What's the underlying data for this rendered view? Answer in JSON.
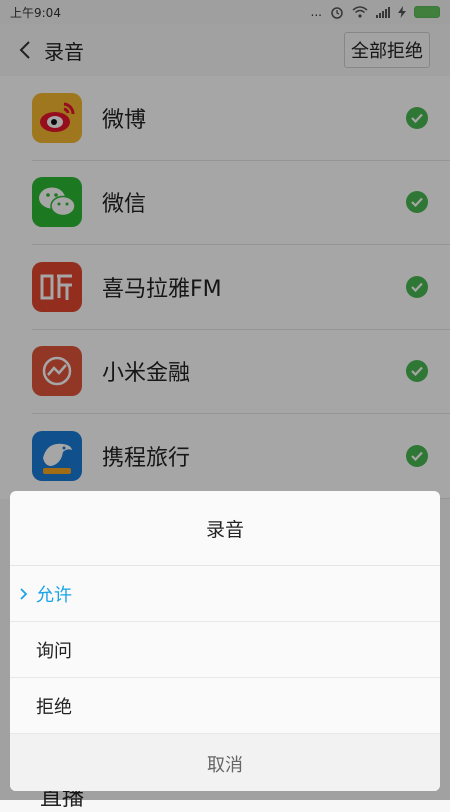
{
  "status": {
    "time": "上午9:04",
    "dots": "...",
    "icons": [
      "alarm-icon",
      "wifi-icon",
      "signal-icon",
      "charging-icon",
      "battery-icon"
    ]
  },
  "header": {
    "title": "录音",
    "deny_all": "全部拒绝"
  },
  "apps": [
    {
      "name": "微博",
      "icon": "weibo-icon",
      "color": "#f4b730"
    },
    {
      "name": "微信",
      "icon": "wechat-icon",
      "color": "#2db935"
    },
    {
      "name": "喜马拉雅FM",
      "icon": "ximalaya-icon",
      "color": "#e2452f"
    },
    {
      "name": "小米金融",
      "icon": "mi-finance-icon",
      "color": "#e0553b"
    },
    {
      "name": "携程旅行",
      "icon": "ctrip-icon",
      "color": "#1a7bd7"
    }
  ],
  "peek_item": "直播",
  "sheet": {
    "title": "录音",
    "options": [
      {
        "label": "允许",
        "selected": true
      },
      {
        "label": "询问",
        "selected": false
      },
      {
        "label": "拒绝",
        "selected": false
      }
    ],
    "cancel": "取消"
  },
  "colors": {
    "check": "#49b750",
    "selected": "#1aa3e8"
  }
}
